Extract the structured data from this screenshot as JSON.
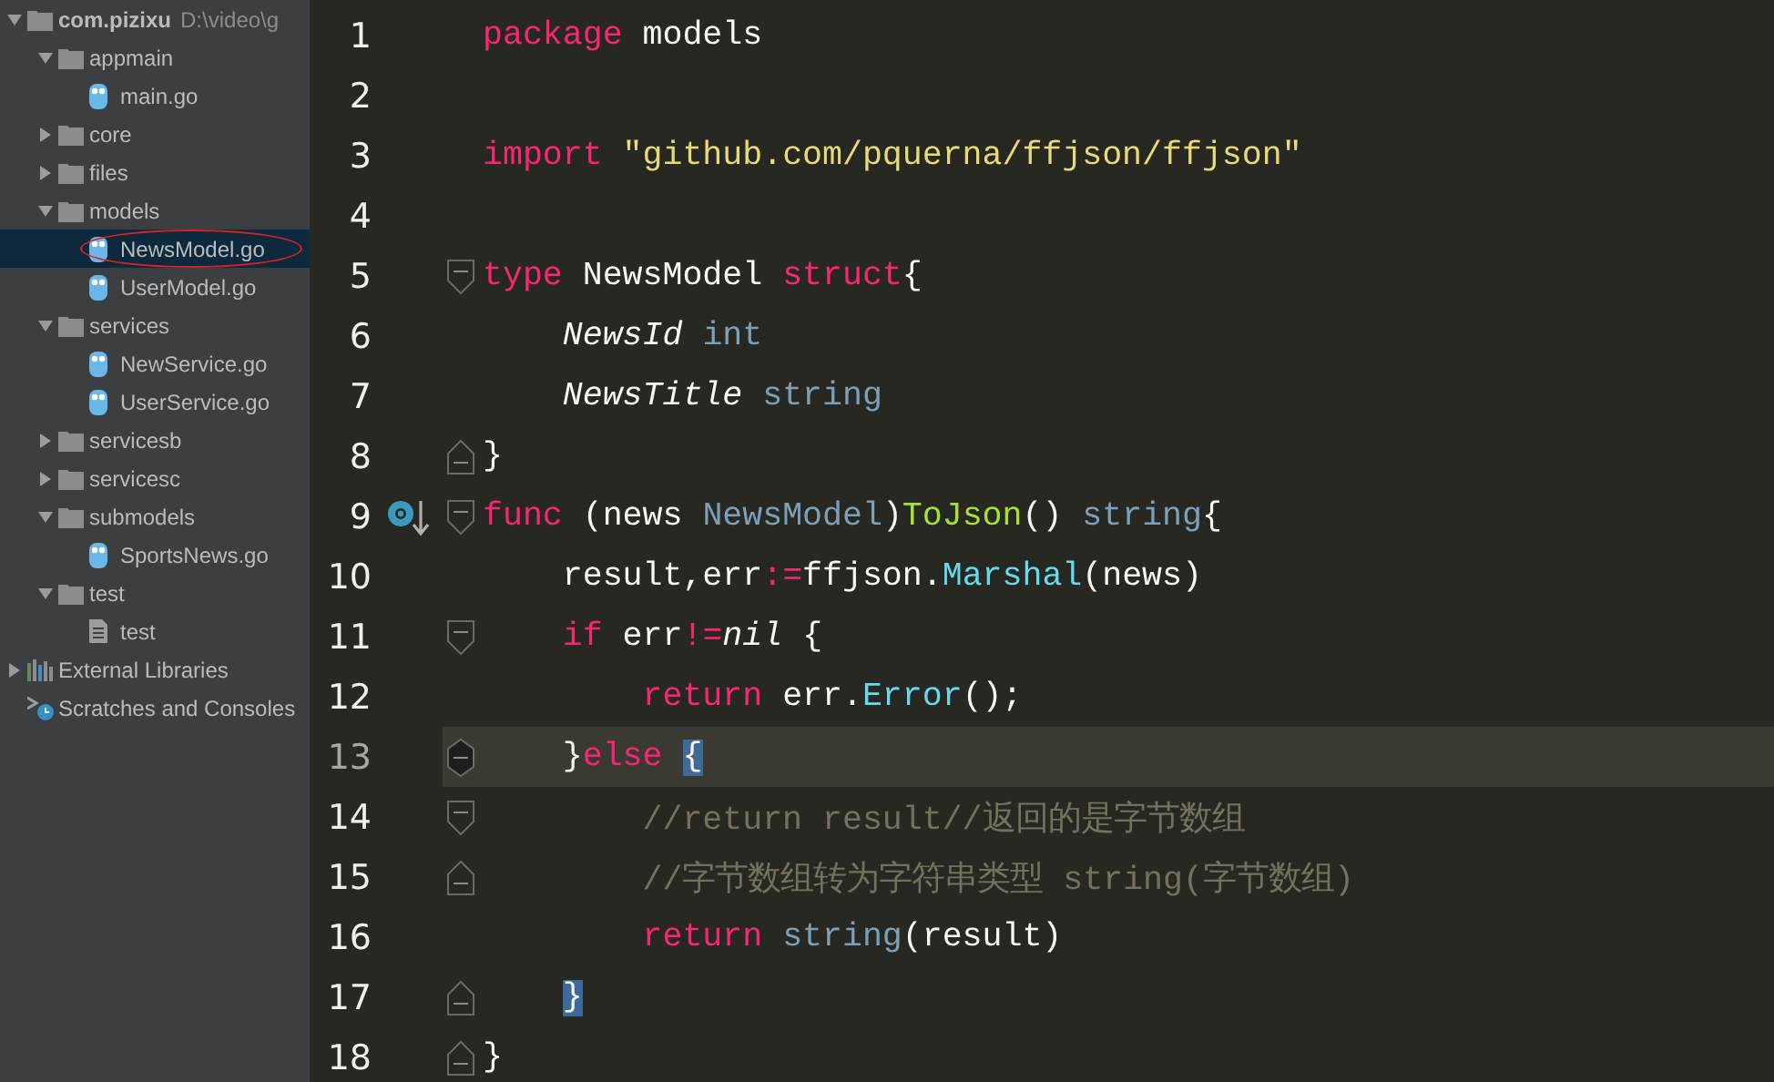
{
  "project_tree": {
    "items": [
      {
        "kind": "folder",
        "label": "com.pizixu",
        "path": "D:\\video\\g",
        "expanded": true,
        "selected": false,
        "children": [
          {
            "kind": "folder",
            "label": "appmain",
            "expanded": true,
            "selected": false,
            "children": [
              {
                "kind": "go",
                "label": "main.go",
                "selected": false
              }
            ]
          },
          {
            "kind": "folder",
            "label": "core",
            "expanded": false,
            "selected": false
          },
          {
            "kind": "folder",
            "label": "files",
            "expanded": false,
            "selected": false
          },
          {
            "kind": "folder",
            "label": "models",
            "expanded": true,
            "selected": false,
            "children": [
              {
                "kind": "go",
                "label": "NewsModel.go",
                "selected": true,
                "circled": true
              },
              {
                "kind": "go",
                "label": "UserModel.go",
                "selected": false
              }
            ]
          },
          {
            "kind": "folder",
            "label": "services",
            "expanded": true,
            "selected": false,
            "children": [
              {
                "kind": "go",
                "label": "NewService.go",
                "selected": false
              },
              {
                "kind": "go",
                "label": "UserService.go",
                "selected": false
              }
            ]
          },
          {
            "kind": "folder",
            "label": "servicesb",
            "expanded": false,
            "selected": false
          },
          {
            "kind": "folder",
            "label": "servicesc",
            "expanded": false,
            "selected": false
          },
          {
            "kind": "folder",
            "label": "submodels",
            "expanded": true,
            "selected": false,
            "children": [
              {
                "kind": "go",
                "label": "SportsNews.go",
                "selected": false
              }
            ]
          },
          {
            "kind": "folder",
            "label": "test",
            "expanded": true,
            "selected": false,
            "children": [
              {
                "kind": "text",
                "label": "test",
                "selected": false
              }
            ]
          }
        ]
      },
      {
        "kind": "library",
        "label": "External Libraries",
        "expanded": false,
        "selected": false
      },
      {
        "kind": "scratches",
        "label": "Scratches and Consoles",
        "selected": false
      }
    ]
  },
  "editor": {
    "lines": [
      {
        "number": "1",
        "current": false,
        "tokens": [
          {
            "kind": "kw",
            "text": "package"
          },
          {
            "kind": "plain",
            "text": " models"
          }
        ]
      },
      {
        "number": "2",
        "current": false
      },
      {
        "number": "3",
        "current": false,
        "tokens": [
          {
            "kind": "kw",
            "text": "import"
          },
          {
            "kind": "str",
            "text": " \"github.com/pquerna/ffjson/ffjson\""
          }
        ]
      },
      {
        "number": "4",
        "current": false
      },
      {
        "number": "5",
        "current": false,
        "fold_start": true,
        "tokens": [
          {
            "kind": "kw",
            "text": "type"
          },
          {
            "kind": "plain",
            "text": " NewsModel "
          },
          {
            "kind": "kw",
            "text": "struct"
          },
          {
            "kind": "plain",
            "text": "{"
          }
        ]
      },
      {
        "number": "6",
        "current": false,
        "tokens": [
          {
            "kind": "field",
            "text": "    NewsId"
          },
          {
            "kind": "type",
            "text": " int"
          }
        ]
      },
      {
        "number": "7",
        "current": false,
        "tokens": [
          {
            "kind": "field",
            "text": "    NewsTitle"
          },
          {
            "kind": "type",
            "text": " string"
          }
        ]
      },
      {
        "number": "8",
        "current": false,
        "fold_end": true,
        "tokens": [
          {
            "kind": "plain",
            "text": "}"
          }
        ]
      },
      {
        "number": "9",
        "current": false,
        "fold_start": true,
        "implementation_marker": true,
        "tokens": [
          {
            "kind": "kw",
            "text": "func"
          },
          {
            "kind": "plain",
            "text": " (news "
          },
          {
            "kind": "type",
            "text": "NewsModel"
          },
          {
            "kind": "plain",
            "text": ")"
          },
          {
            "kind": "fn",
            "text": "ToJson"
          },
          {
            "kind": "plain",
            "text": "() "
          },
          {
            "kind": "type",
            "text": "string"
          },
          {
            "kind": "plain",
            "text": "{"
          }
        ]
      },
      {
        "number": "10",
        "current": false,
        "tokens": [
          {
            "kind": "plain",
            "text": "    result,err"
          },
          {
            "kind": "op",
            "text": ":="
          },
          {
            "kind": "plain",
            "text": "ffjson."
          },
          {
            "kind": "method",
            "text": "Marshal"
          },
          {
            "kind": "plain",
            "text": "(news)"
          }
        ]
      },
      {
        "number": "11",
        "current": false,
        "fold_start": true,
        "tokens": [
          {
            "kind": "kw",
            "text": "    if"
          },
          {
            "kind": "plain",
            "text": " err"
          },
          {
            "kind": "op",
            "text": "!="
          },
          {
            "kind": "const",
            "text": "nil"
          },
          {
            "kind": "plain",
            "text": " {"
          }
        ]
      },
      {
        "number": "12",
        "current": false,
        "tokens": [
          {
            "kind": "kw",
            "text": "        return"
          },
          {
            "kind": "plain",
            "text": " err."
          },
          {
            "kind": "method",
            "text": "Error"
          },
          {
            "kind": "plain",
            "text": "();"
          }
        ]
      },
      {
        "number": "13",
        "current": true,
        "fold_start": true,
        "fold_end": true,
        "tokens": [
          {
            "kind": "plain",
            "text": "    }"
          },
          {
            "kind": "kw",
            "text": "else"
          },
          {
            "kind": "plain",
            "text": " {",
            "matched": true
          }
        ]
      },
      {
        "number": "14",
        "current": false,
        "fold_start": true,
        "tokens": [
          {
            "kind": "comment",
            "text": "        //return result//返回的是字节数组"
          }
        ]
      },
      {
        "number": "15",
        "current": false,
        "fold_end": true,
        "tokens": [
          {
            "kind": "comment",
            "text": "        //字节数组转为字符串类型 string(字节数组)"
          }
        ]
      },
      {
        "number": "16",
        "current": false,
        "tokens": [
          {
            "kind": "kw",
            "text": "        return"
          },
          {
            "kind": "type",
            "text": " string"
          },
          {
            "kind": "plain",
            "text": "(result)"
          }
        ]
      },
      {
        "number": "17",
        "current": false,
        "fold_end": true,
        "tokens": [
          {
            "kind": "plain",
            "text": "    }",
            "matched": true
          }
        ]
      },
      {
        "number": "18",
        "current": false,
        "fold_end": true,
        "tokens": [
          {
            "kind": "plain",
            "text": "}"
          }
        ]
      }
    ]
  }
}
